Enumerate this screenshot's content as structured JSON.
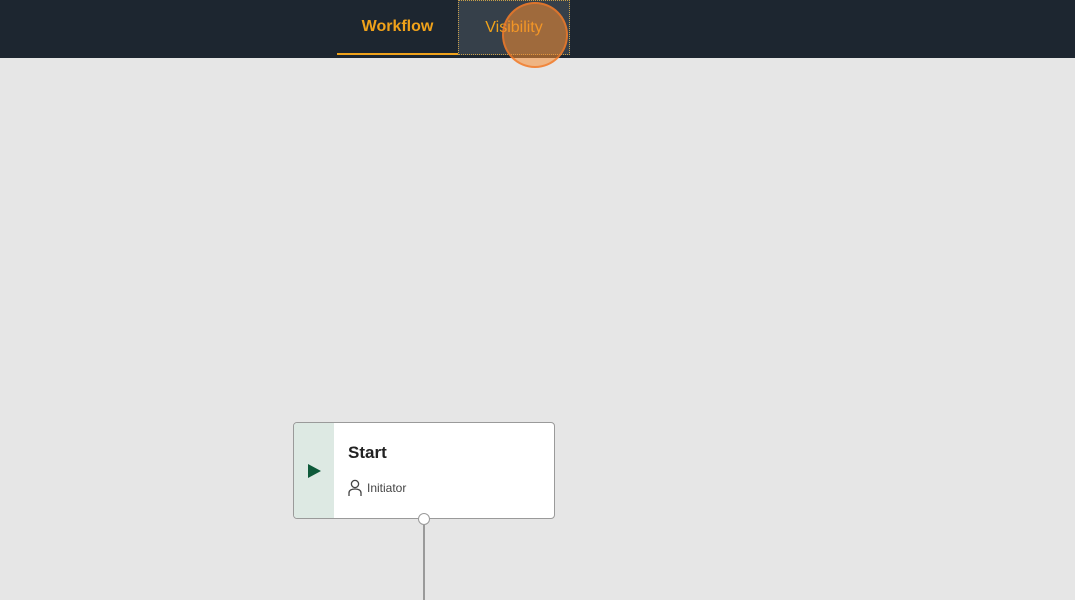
{
  "tabs": [
    {
      "label": "Workflow",
      "active": true
    },
    {
      "label": "Visibility",
      "active": false,
      "focused": true
    }
  ],
  "node": {
    "title": "Start",
    "role": "Initiator",
    "icon": "play-icon",
    "role_icon": "person-icon"
  },
  "colors": {
    "topbar": "#1d2630",
    "accent": "#f0a21a",
    "canvas": "#e6e6e6",
    "start_green": "#0e5a3a"
  }
}
